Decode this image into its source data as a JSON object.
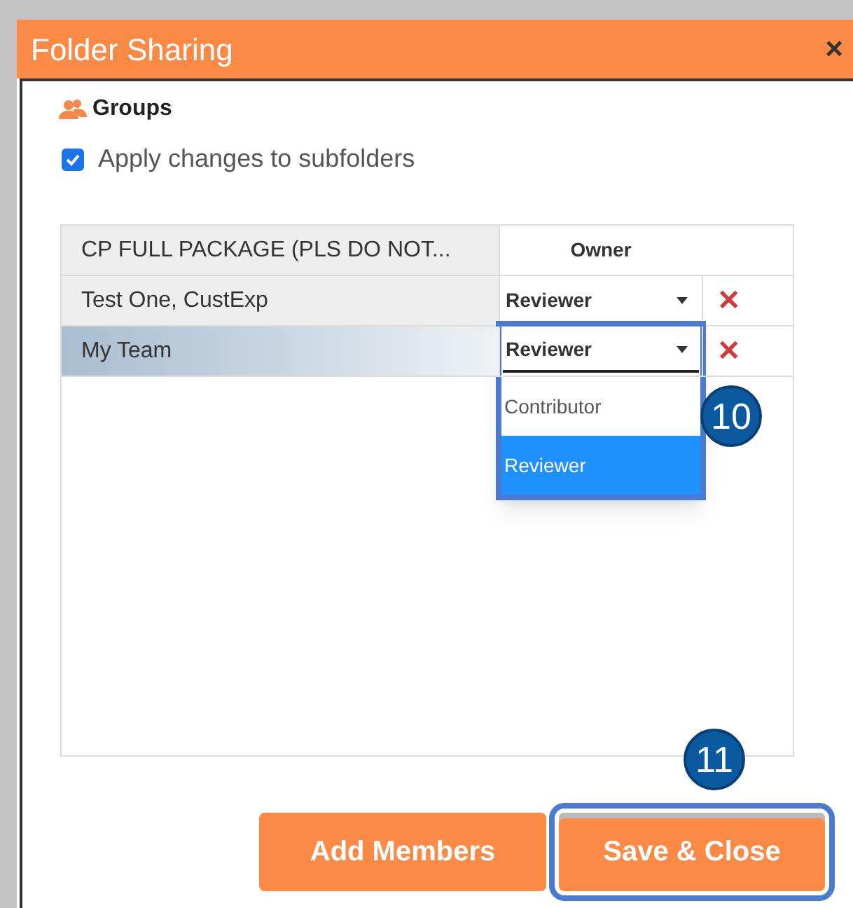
{
  "window": {
    "title": "Folder Sharing",
    "close": "×"
  },
  "section": {
    "label": "Groups"
  },
  "apply_subfolders": {
    "label": "Apply changes to subfolders",
    "checked": true
  },
  "members": [
    {
      "name": "CP FULL PACKAGE (PLS DO NOT...",
      "kind": "owner",
      "role": "Owner",
      "selected": false
    },
    {
      "name": "Test One, CustExp",
      "kind": "select",
      "role": "Reviewer",
      "selected": false,
      "remove": "✕"
    },
    {
      "name": "My Team",
      "kind": "select",
      "role": "Reviewer",
      "selected": true,
      "remove": "✕",
      "open": true
    }
  ],
  "role_options": [
    {
      "label": "Contributor",
      "selected": false
    },
    {
      "label": "Reviewer",
      "selected": true
    }
  ],
  "callouts": [
    "10",
    "11"
  ],
  "buttons": [
    {
      "label": "Add Members",
      "highlighted": false
    },
    {
      "label": "Save & Close",
      "highlighted": true
    }
  ]
}
